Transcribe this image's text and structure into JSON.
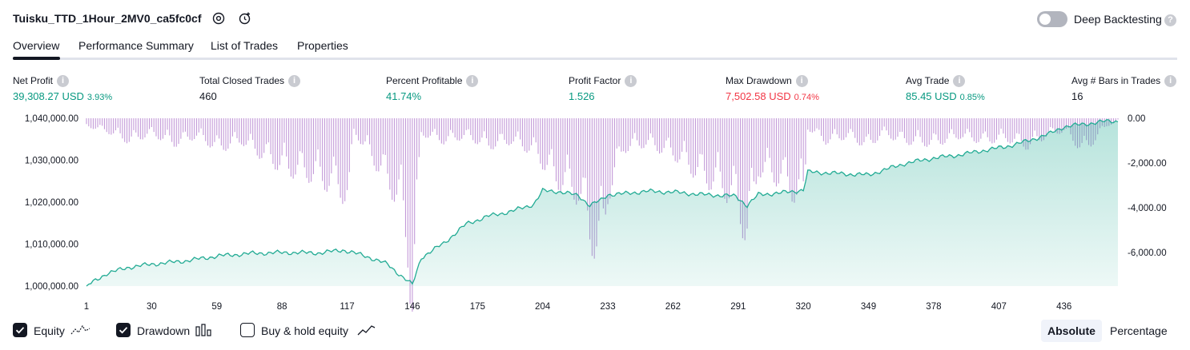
{
  "header": {
    "strategy_name": "Tuisku_TTD_1Hour_2MV0_ca5fc0cf",
    "deep_backtesting_label": "Deep Backtesting",
    "deep_backtesting_enabled": false
  },
  "tabs": [
    {
      "label": "Overview",
      "active": true
    },
    {
      "label": "Performance Summary",
      "active": false
    },
    {
      "label": "List of Trades",
      "active": false
    },
    {
      "label": "Properties",
      "active": false
    }
  ],
  "metrics": [
    {
      "label": "Net Profit",
      "value": "39,308.27 USD",
      "pct": "3.93%",
      "color": "green"
    },
    {
      "label": "Total Closed Trades",
      "value": "460",
      "pct": "",
      "color": "dark"
    },
    {
      "label": "Percent Profitable",
      "value": "41.74%",
      "pct": "",
      "color": "green"
    },
    {
      "label": "Profit Factor",
      "value": "1.526",
      "pct": "",
      "color": "green"
    },
    {
      "label": "Max Drawdown",
      "value": "7,502.58 USD",
      "pct": "0.74%",
      "color": "red"
    },
    {
      "label": "Avg Trade",
      "value": "85.45 USD",
      "pct": "0.85%",
      "color": "green"
    },
    {
      "label": "Avg # Bars in Trades",
      "value": "16",
      "pct": "",
      "color": "dark"
    }
  ],
  "chart_data": {
    "type": "area",
    "left_axis_labels": [
      "1,040,000.00",
      "1,030,000.00",
      "1,020,000.00",
      "1,010,000.00",
      "1,000,000.00"
    ],
    "left_axis_values": [
      1040000,
      1030000,
      1020000,
      1010000,
      1000000
    ],
    "right_axis_labels": [
      "0.00",
      "-2,000.00",
      "-4,000.00",
      "-6,000.00"
    ],
    "right_axis_values": [
      0,
      -2000,
      -4000,
      -6000
    ],
    "x_tick_labels": [
      "1",
      "30",
      "59",
      "88",
      "117",
      "146",
      "175",
      "204",
      "233",
      "262",
      "291",
      "320",
      "349",
      "378",
      "407",
      "436"
    ],
    "x_range": [
      1,
      460
    ],
    "equity_range": [
      1000000,
      1040000
    ],
    "drawdown_range": [
      -7502.58,
      0
    ],
    "equity_series": {
      "x": [
        1,
        10,
        20,
        30,
        45,
        60,
        75,
        90,
        105,
        115,
        125,
        135,
        142,
        146,
        150,
        160,
        170,
        180,
        190,
        200,
        204,
        210,
        220,
        225,
        230,
        233,
        240,
        250,
        262,
        275,
        285,
        290,
        295,
        300,
        310,
        320,
        322,
        330,
        340,
        349,
        355,
        365,
        378,
        390,
        400,
        410,
        420,
        430,
        436,
        445,
        455,
        460
      ],
      "values": [
        1000000,
        1003000,
        1004500,
        1005200,
        1006000,
        1007200,
        1007800,
        1008000,
        1007900,
        1008600,
        1007200,
        1005200,
        1002000,
        1000300,
        1006800,
        1010200,
        1014800,
        1016700,
        1017800,
        1019500,
        1022700,
        1022600,
        1021600,
        1019200,
        1020500,
        1021800,
        1022000,
        1022600,
        1022400,
        1021800,
        1021600,
        1021400,
        1019200,
        1021800,
        1022200,
        1022900,
        1027200,
        1027000,
        1026700,
        1026500,
        1027500,
        1029200,
        1030500,
        1031300,
        1032300,
        1033200,
        1034600,
        1036400,
        1038000,
        1038600,
        1039300,
        1039300
      ]
    },
    "drawdown_series": {
      "x": [
        1,
        10,
        20,
        30,
        40,
        50,
        60,
        70,
        80,
        90,
        100,
        110,
        118,
        120,
        130,
        140,
        144,
        146,
        150,
        160,
        170,
        180,
        190,
        200,
        210,
        220,
        225,
        230,
        233,
        240,
        250,
        262,
        275,
        285,
        290,
        295,
        300,
        310,
        320,
        322,
        330,
        340,
        349,
        355,
        365,
        378,
        390,
        400,
        410,
        420,
        430,
        436,
        445,
        455,
        460
      ],
      "values": [
        -300,
        -500,
        -900,
        -600,
        -1000,
        -700,
        -1200,
        -900,
        -1500,
        -2000,
        -2200,
        -2600,
        -3100,
        -500,
        -1800,
        -3200,
        -5200,
        -7500,
        -600,
        -900,
        -700,
        -1100,
        -900,
        -1300,
        -2400,
        -3000,
        -4500,
        -5500,
        -3000,
        -1200,
        -1000,
        -1400,
        -2300,
        -2800,
        -3300,
        -4600,
        -2000,
        -2400,
        -3300,
        -400,
        -900,
        -700,
        -1100,
        -600,
        -900,
        -1000,
        -700,
        -900,
        -800,
        -1100,
        -600,
        -500,
        -1300,
        -300,
        -100
      ]
    },
    "legend": [
      {
        "label": "Equity",
        "checked": true,
        "icon": "equity-line-icon"
      },
      {
        "label": "Drawdown",
        "checked": true,
        "icon": "drawdown-bars-icon"
      },
      {
        "label": "Buy & hold equity",
        "checked": false,
        "icon": "buy-hold-line-icon"
      }
    ],
    "equity_color": "#22ab94",
    "drawdown_color": "#c39ad8"
  },
  "footer": {
    "mode_absolute": "Absolute",
    "mode_percentage": "Percentage",
    "active_mode": "Absolute"
  }
}
